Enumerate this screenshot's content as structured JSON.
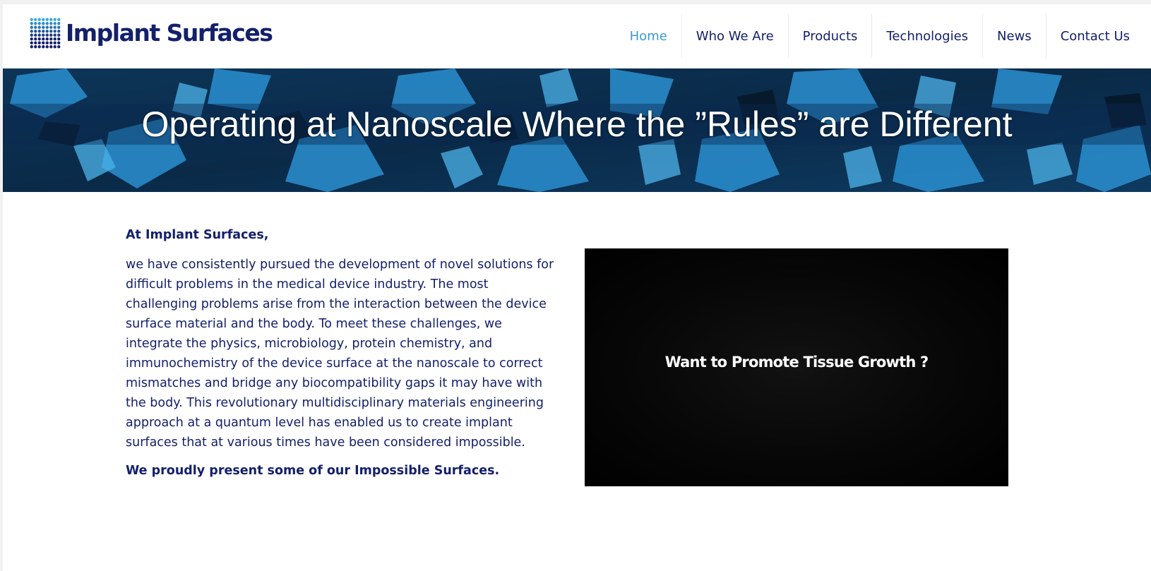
{
  "brand": {
    "name": "Implant Surfaces",
    "logo_icon": "dot-grid-logo-icon",
    "primary_color": "#14206b",
    "accent_color": "#3a9ad9"
  },
  "nav": {
    "items": [
      {
        "label": "Home",
        "active": true
      },
      {
        "label": "Who We Are",
        "active": false
      },
      {
        "label": "Products",
        "active": false
      },
      {
        "label": "Technologies",
        "active": false
      },
      {
        "label": "News",
        "active": false
      },
      {
        "label": "Contact Us",
        "active": false
      }
    ]
  },
  "banner": {
    "title": "Operating at Nanoscale Where the ”Rules” are Different"
  },
  "intro": {
    "heading": "At Implant Surfaces,",
    "body": "we have consistently pursued the development of novel solutions for difficult problems in the medical device industry. The most challenging problems arise from the interaction between the device surface material and the body. To meet these challenges, we integrate the physics, microbiology, protein chemistry, and immunochemistry of the device surface at the nanoscale to correct mismatches and bridge any biocompatibility gaps it may have with the body. This revolutionary multidisciplinary materials engineering approach at a quantum level has enabled us to create implant surfaces that at various times have been considered impossible.",
    "closing": "We proudly present some of our Impossible Surfaces."
  },
  "video": {
    "caption": "Want to Promote Tissue Growth ?"
  }
}
